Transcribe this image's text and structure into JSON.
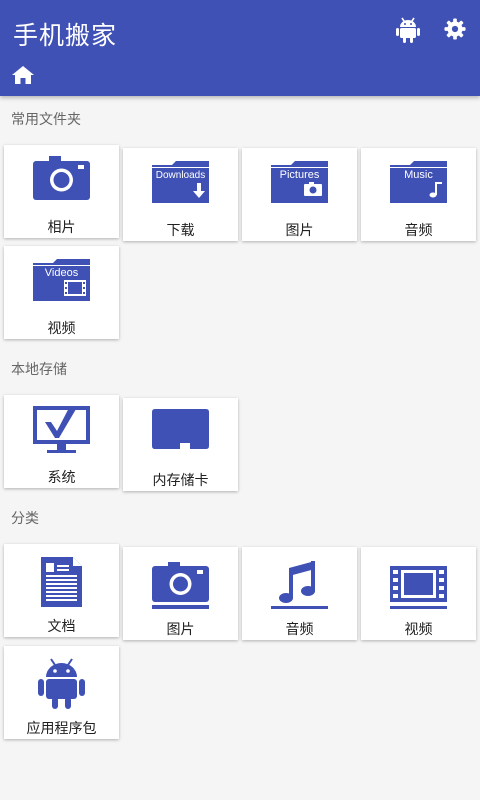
{
  "app": {
    "title": "手机搬家",
    "colors": {
      "primary": "#3f51b5",
      "background": "#f5f5f5",
      "tile": "#ffffff"
    },
    "icons": [
      "android-icon",
      "settings-gear-icon",
      "home-icon"
    ]
  },
  "sections": {
    "common_folders": {
      "title": "常用文件夹",
      "items": [
        {
          "label": "相片",
          "icon": "camera-icon"
        },
        {
          "label": "下载",
          "icon": "downloads-folder-icon",
          "icon_text": "Downloads"
        },
        {
          "label": "图片",
          "icon": "pictures-folder-icon",
          "icon_text": "Pictures"
        },
        {
          "label": "音频",
          "icon": "music-folder-icon",
          "icon_text": "Music"
        },
        {
          "label": "视频",
          "icon": "videos-folder-icon",
          "icon_text": "Videos"
        }
      ]
    },
    "local_storage": {
      "title": "本地存储",
      "items": [
        {
          "label": "系统",
          "icon": "monitor-check-icon"
        },
        {
          "label": "内存储卡",
          "icon": "sd-card-icon"
        }
      ]
    },
    "categories": {
      "title": "分类",
      "items": [
        {
          "label": "文档",
          "icon": "document-icon"
        },
        {
          "label": "图片",
          "icon": "camera-icon"
        },
        {
          "label": "音频",
          "icon": "music-note-icon"
        },
        {
          "label": "视频",
          "icon": "film-icon"
        },
        {
          "label": "应用程序包",
          "icon": "android-icon"
        }
      ]
    }
  }
}
